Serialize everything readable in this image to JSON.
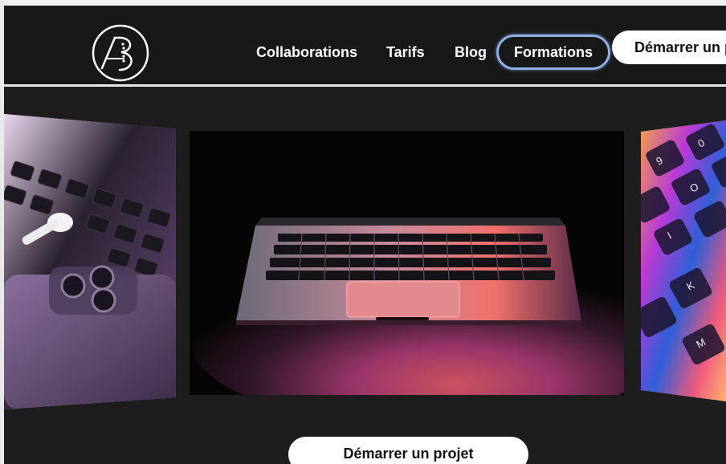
{
  "header": {
    "logo": "AB logo mark",
    "nav": [
      {
        "label": "Collaborations",
        "active": false
      },
      {
        "label": "Tarifs",
        "active": false
      },
      {
        "label": "Blog",
        "active": false
      },
      {
        "label": "Formations",
        "active": true
      }
    ],
    "cta_label": "Démarrer un projet"
  },
  "carousel": {
    "slides": [
      {
        "name": "laptop-keyboard-airpods-iphone"
      },
      {
        "name": "macbook-dark-glow"
      },
      {
        "name": "colorful-keyboard-closeup"
      }
    ]
  },
  "main": {
    "cta_label": "Démarrer un projet"
  },
  "colors": {
    "background": "#1c1c1c",
    "header_bg": "#181818",
    "active_outline": "#8fb0e8",
    "button_bg": "#ffffff"
  }
}
